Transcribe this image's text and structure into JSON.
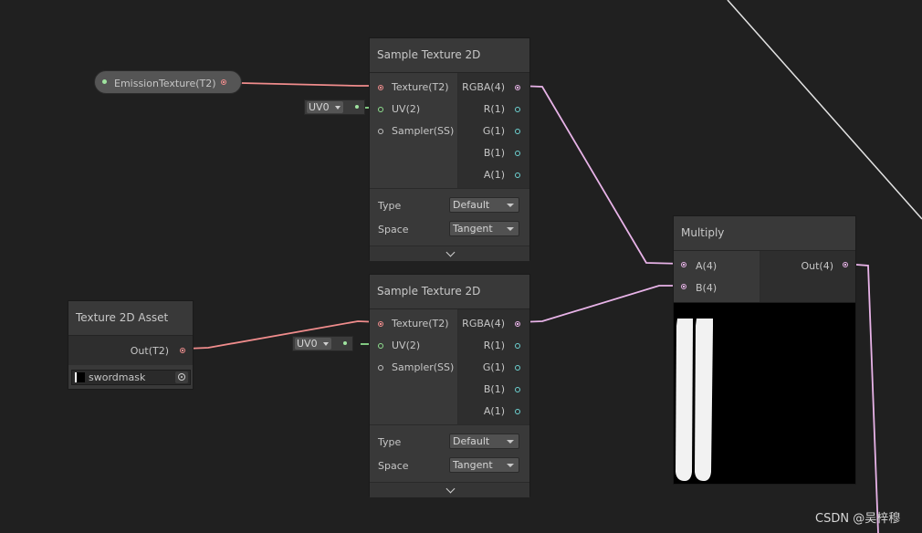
{
  "colors": {
    "background": "#202020",
    "node_body": "#393939",
    "wire_texture": "#f08c8c",
    "wire_vector4": "#e8b3e8",
    "wire_vector2": "#8fe08f",
    "wire_white": "#e8e8e8"
  },
  "property_node": {
    "label": "EmissionTexture(T2)"
  },
  "sample_texture_top": {
    "title": "Sample Texture 2D",
    "inputs": [
      "Texture(T2)",
      "UV(2)",
      "Sampler(SS)"
    ],
    "outputs": [
      "RGBA(4)",
      "R(1)",
      "G(1)",
      "B(1)",
      "A(1)"
    ],
    "uv_value": "UV0",
    "type_label": "Type",
    "type_value": "Default",
    "space_label": "Space",
    "space_value": "Tangent"
  },
  "sample_texture_bottom": {
    "title": "Sample Texture 2D",
    "inputs": [
      "Texture(T2)",
      "UV(2)",
      "Sampler(SS)"
    ],
    "outputs": [
      "RGBA(4)",
      "R(1)",
      "G(1)",
      "B(1)",
      "A(1)"
    ],
    "uv_value": "UV0",
    "type_label": "Type",
    "type_value": "Default",
    "space_label": "Space",
    "space_value": "Tangent"
  },
  "texture_asset": {
    "title": "Texture 2D Asset",
    "output": "Out(T2)",
    "asset_name": "swordmask"
  },
  "multiply": {
    "title": "Multiply",
    "inputs": [
      "A(4)",
      "B(4)"
    ],
    "output": "Out(4)"
  },
  "watermark": "CSDN @吴梓穆"
}
